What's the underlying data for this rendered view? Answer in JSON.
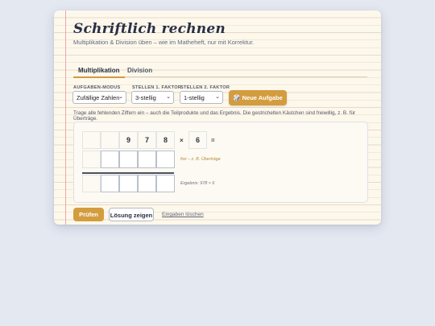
{
  "header": {
    "title": "Schriftlich rechnen",
    "subtitle": "Multiplikation & Division üben – wie im Matheheft, nur mit Korrektur."
  },
  "tabs": [
    {
      "label": "Multiplikation",
      "active": true
    },
    {
      "label": "Division",
      "active": false
    }
  ],
  "controls": {
    "mode": {
      "label": "AUFGABEN-MODUS",
      "value": "Zufällige Zahlen"
    },
    "factor1": {
      "label": "STELLEN 1. FAKTOR",
      "value": "3-stellig"
    },
    "factor2": {
      "label": "STELLEN 2. FAKTOR",
      "value": "1-stellig"
    },
    "new_task_label": "🎲 Neue Aufgabe"
  },
  "hint": "Trage alle fehlenden Ziffern ein – auch die Teilprodukte und das Ergebnis. Die gestrichelten Kästchen sind freiwillig, z. B. für Überträge.",
  "task": {
    "digits": [
      "9",
      "7",
      "8"
    ],
    "operator": "×",
    "factor2": "6",
    "equals": "=",
    "carry_note": "frei – z. B. Überträge",
    "result_note": "Ergebnis: 978 × 6"
  },
  "actions": {
    "check_label": "Prüfen",
    "solution_label": "Lösung zeigen",
    "clear_label": "Eingaben löschen"
  },
  "colors": {
    "accent": "#d39c3e",
    "paper": "#fdf8ec",
    "background": "#e3e8f1"
  }
}
